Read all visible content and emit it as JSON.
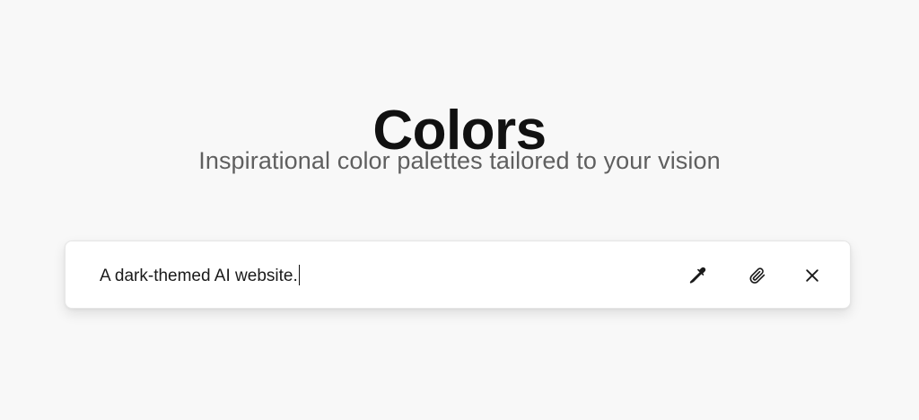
{
  "header": {
    "title": "Colors",
    "subtitle": "Inspirational color palettes tailored to your vision"
  },
  "search": {
    "value": "A dark-themed AI website.",
    "icons": {
      "eyedropper": "eyedropper-icon",
      "attach": "paperclip-icon",
      "clear": "close-icon"
    }
  },
  "colors": {
    "background": "#f8f8f8",
    "title": "#111111",
    "subtitle": "#5f5f5f",
    "input_surface": "#ffffff"
  }
}
